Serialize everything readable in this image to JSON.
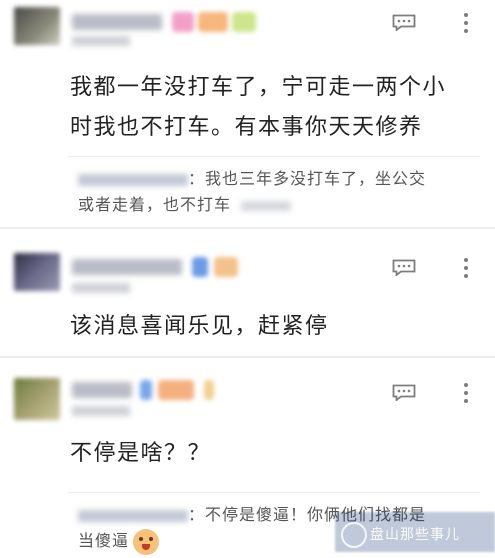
{
  "comments": [
    {
      "body_lines": [
        "我都一年没打车了，宁可走一两个小",
        "时我也不打车。有本事你天天修养"
      ],
      "reply": {
        "text_lines": [
          "：我也三年多没打车了，坐公交",
          "或者走着，也不打车"
        ]
      }
    },
    {
      "body_lines": [
        "该消息喜闻乐见，赶紧停"
      ]
    },
    {
      "body_lines": [
        "不停是啥？？"
      ],
      "reply": {
        "text_lines": [
          "：不停是傻逼！你俩他们找都是",
          "当傻逼"
        ]
      }
    }
  ],
  "icons": {
    "reply": "comment-reply-icon",
    "more": "more-vertical-icon",
    "emoji": "angry-face-emoji-icon",
    "watermark": "watermark-logo-icon"
  },
  "colors": {
    "icon": "#7d7d7d",
    "body_text": "#222222",
    "reply_text": "#555555",
    "separator": "#ededed"
  },
  "watermark": {
    "text": "盘山那些事儿"
  }
}
